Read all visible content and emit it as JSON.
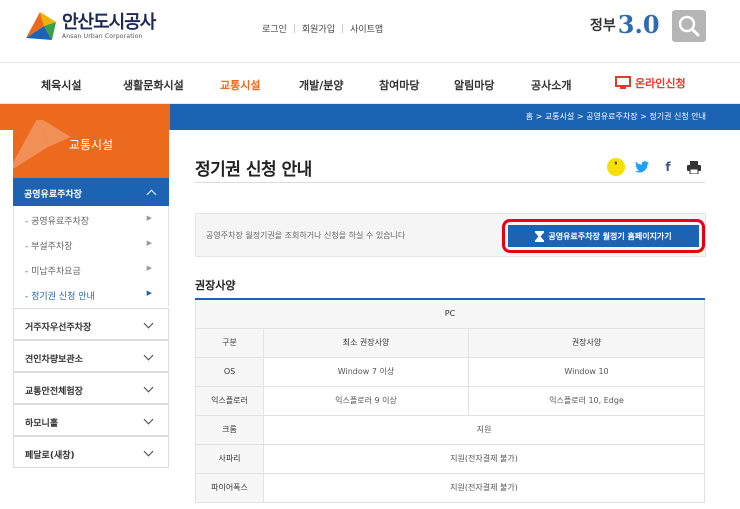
{
  "header": {
    "logo_name": "안산도시공사",
    "logo_sub": "Ansan Urban Corporation",
    "util_links": [
      "로그인",
      "회원가입",
      "사이트맵"
    ],
    "gov_text": "정부",
    "gov_num": "3.0"
  },
  "gnb": {
    "items": [
      "체육시설",
      "생활문화시설",
      "교통시설",
      "개발/분양",
      "참여마당",
      "알림마당",
      "공사소개"
    ],
    "online": "온라인신청"
  },
  "breadcrumb": "홈 > 교통시설 > 공영유료주차장 > 정기권 신청 안내",
  "sidebar": {
    "title": "교통시설",
    "active_menu": "공영유료주차장",
    "sub_items": [
      "- 공영유료주차장",
      "- 부설주차장",
      "- 미납주차요금",
      "- 정기권 신청 안내"
    ],
    "menus": [
      "거주자우선주차장",
      "견인차량보관소",
      "교통안전체험장",
      "하모니홀",
      "페달로(새창)"
    ]
  },
  "main": {
    "title": "정기권 신청 안내",
    "notice_text": "공영주차장 월정기권을 조회하거나 신청을 하실 수 있습니다",
    "go_button": "공영유료주차장 월정기 홈페이지가기",
    "section_title": "권장사양",
    "table": {
      "caption": "PC",
      "headers": [
        "구분",
        "최소 권장사양",
        "권장사양"
      ],
      "rows": [
        {
          "label": "OS",
          "min": "Window 7 이상",
          "rec": "Window 10"
        },
        {
          "label": "익스플로러",
          "min": "익스플로러 9 이상",
          "rec": "익스플로러 10, Edge"
        },
        {
          "label": "크롬",
          "merged": "지원"
        },
        {
          "label": "사파리",
          "merged": "지원(전자결제 불가)"
        },
        {
          "label": "파이어폭스",
          "merged": "지원(전자결제 불가)"
        }
      ]
    }
  },
  "colors": {
    "accent_orange": "#ec6a1d",
    "accent_blue": "#1d63b4",
    "highlight_red": "#e60012"
  }
}
